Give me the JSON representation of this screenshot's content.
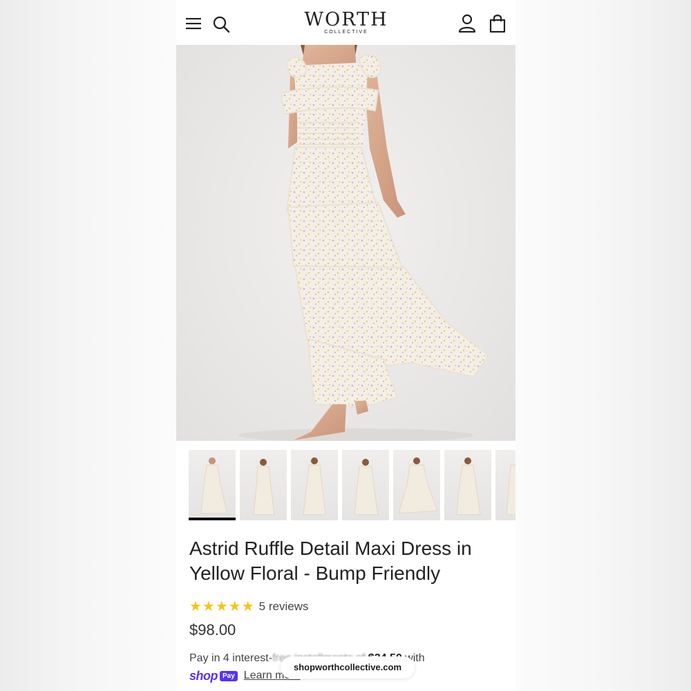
{
  "header": {
    "logo_main": "WORTH",
    "logo_sub": "COLLECTIVE",
    "icons": [
      "menu-icon",
      "search-icon",
      "account-icon",
      "bag-icon"
    ]
  },
  "gallery": {
    "main_image": "model wearing floral tiered ruffle maxi dress",
    "thumbnail_count_visible": 7,
    "active_thumbnail": 1
  },
  "product": {
    "title": "Astrid Ruffle Detail Maxi Dress in Yellow Floral - Bump Friendly",
    "stars": "★★★★★",
    "rating": 5,
    "reviews_label": "5 reviews",
    "price": "$98.00"
  },
  "payment": {
    "prefix": "Pay in 4 interest-",
    "obscured": "free installments of",
    "amount": "$24.50",
    "suffix": "with",
    "shop_label": "shop",
    "pay_label": "Pay",
    "learn_more": "Learn more"
  },
  "browser": {
    "url": "shopworthcollective.com"
  },
  "colors": {
    "star": "#f5c518",
    "shop_pay": "#5a31f4",
    "text": "#222222"
  }
}
